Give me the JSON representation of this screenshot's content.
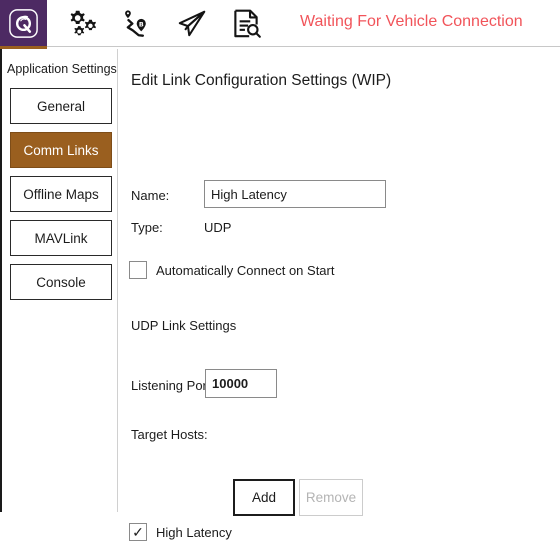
{
  "toolbar": {
    "logo_icon": "qgroundcontrol-logo-icon",
    "icons": [
      {
        "name": "settings-gears-icon",
        "label": "Settings"
      },
      {
        "name": "plan-route-icon",
        "label": "Plan"
      },
      {
        "name": "fly-paper-plane-icon",
        "label": "Fly"
      },
      {
        "name": "analyze-document-search-icon",
        "label": "Analyze"
      }
    ],
    "status_text": "Waiting For Vehicle Connection",
    "status_color": "#f1545a",
    "logo_background": "#4d2a63",
    "indicator_color": "#9a5f1f"
  },
  "sidebar": {
    "title": "Application Settings",
    "selected_index": 1,
    "selected_color": "#9a5f1f",
    "items": [
      {
        "label": "General"
      },
      {
        "label": "Comm Links"
      },
      {
        "label": "Offline Maps"
      },
      {
        "label": "MAVLink"
      },
      {
        "label": "Console"
      }
    ]
  },
  "main": {
    "title": "Edit Link Configuration Settings (WIP)",
    "name": {
      "label": "Name:",
      "value": "High Latency"
    },
    "type": {
      "label": "Type:",
      "value": "UDP"
    },
    "auto_connect": {
      "label": "Automatically Connect on Start",
      "checked": false,
      "mark": ""
    },
    "udp_section_label": "UDP Link Settings",
    "listening_port": {
      "label": "Listening Port",
      "value": "10000"
    },
    "target_hosts_label": "Target Hosts:",
    "add_button": "Add",
    "remove_button": "Remove",
    "high_latency": {
      "label": "High Latency",
      "checked": true,
      "mark": "✓"
    }
  }
}
